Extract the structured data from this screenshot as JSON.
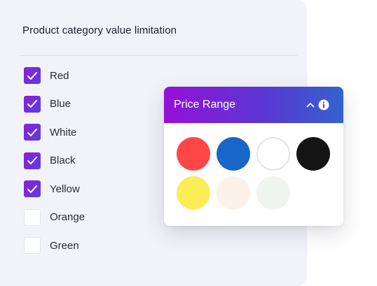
{
  "filter": {
    "title": "Product category value limitation",
    "options": [
      {
        "label": "Red",
        "checked": true
      },
      {
        "label": "Blue",
        "checked": true
      },
      {
        "label": "White",
        "checked": true
      },
      {
        "label": "Black",
        "checked": true
      },
      {
        "label": "Yellow",
        "checked": true
      },
      {
        "label": "Orange",
        "checked": false
      },
      {
        "label": "Green",
        "checked": false
      }
    ]
  },
  "price_card": {
    "title": "Price Range",
    "collapse_icon": "chevron-up-icon",
    "info_icon": "info-icon",
    "swatches": [
      {
        "color": "#ff4747",
        "border": "#ff4747"
      },
      {
        "color": "#1767c8",
        "border": "#1767c8"
      },
      {
        "color": "#ffffff",
        "border": "#e3e4e8"
      },
      {
        "color": "#141414",
        "border": "#141414"
      },
      {
        "color": "#fbed58",
        "border": "#fbed58"
      },
      {
        "color": "#fdf2ea",
        "border": "#fdf2ea"
      },
      {
        "color": "#edf5ee",
        "border": "#edf5ee"
      }
    ]
  },
  "colors": {
    "accent_gradient_start": "#9510d8",
    "accent_gradient_end": "#3462cf",
    "panel_background": "#f2f3f8"
  }
}
